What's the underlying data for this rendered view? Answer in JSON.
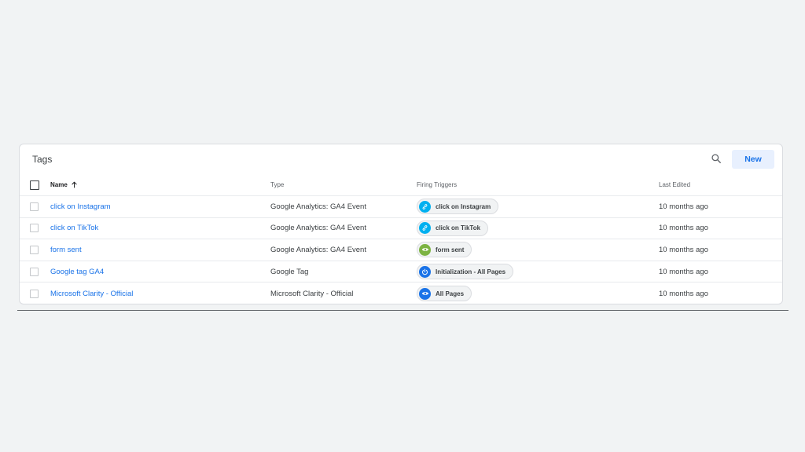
{
  "card": {
    "title": "Tags",
    "new_label": "New"
  },
  "columns": {
    "name": "Name",
    "type": "Type",
    "triggers": "Firing Triggers",
    "edited": "Last Edited"
  },
  "colors": {
    "link": "#1a73e8",
    "trigger_click": "#00b0f0",
    "trigger_form": "#7cb342",
    "trigger_pageview": "#1a73e8"
  },
  "rows": [
    {
      "name": "click on Instagram",
      "type": "Google Analytics: GA4 Event",
      "trigger": "click on Instagram",
      "trigger_icon": "link-icon",
      "edited": "10 months ago"
    },
    {
      "name": "click on TikTok",
      "type": "Google Analytics: GA4 Event",
      "trigger": "click on TikTok",
      "trigger_icon": "link-icon",
      "edited": "10 months ago"
    },
    {
      "name": "form sent",
      "type": "Google Analytics: GA4 Event",
      "trigger": "form sent",
      "trigger_icon": "eye-icon",
      "edited": "10 months ago"
    },
    {
      "name": "Google tag GA4",
      "type": "Google Tag",
      "trigger": "Initialization - All Pages",
      "trigger_icon": "power-icon",
      "edited": "10 months ago"
    },
    {
      "name": "Microsoft Clarity - Official",
      "type": "Microsoft Clarity - Official",
      "trigger": "All Pages",
      "trigger_icon": "eye-icon",
      "edited": "10 months ago"
    }
  ]
}
